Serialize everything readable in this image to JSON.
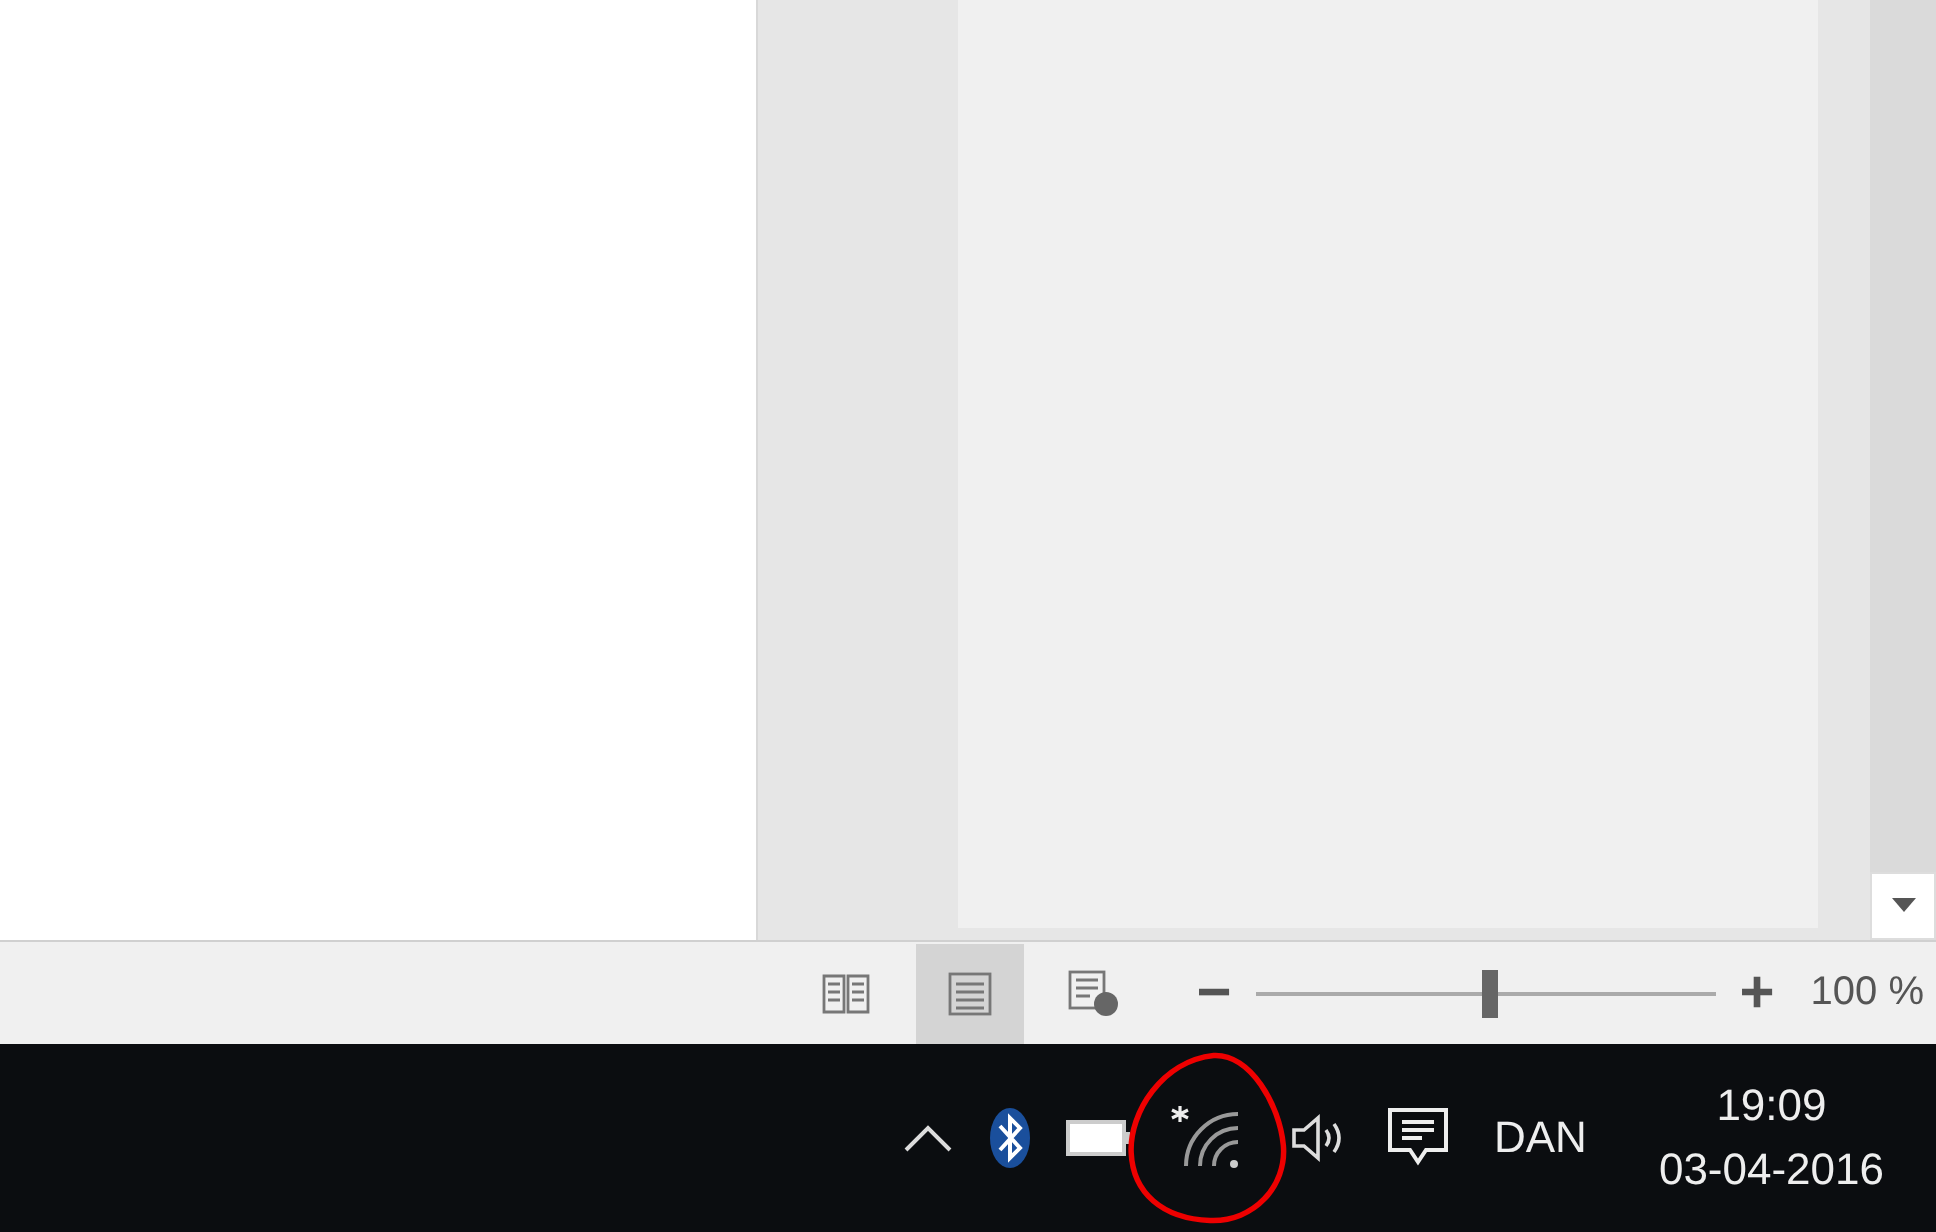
{
  "status_bar": {
    "views": [
      {
        "kind": "read",
        "selected": false
      },
      {
        "kind": "print",
        "selected": true
      },
      {
        "kind": "web",
        "selected": false
      }
    ],
    "zoom": {
      "minus": "−",
      "plus": "+",
      "level": 0.51,
      "reading": "100 %"
    }
  },
  "taskbar": {
    "language": "DAN",
    "time": "19:09",
    "date": "03-04-2016"
  }
}
